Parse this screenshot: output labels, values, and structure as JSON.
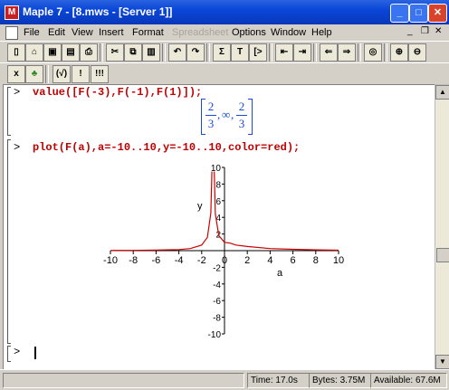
{
  "window": {
    "app_name": "Maple 7",
    "title": "Maple 7 - [8.mws - [Server 1]]"
  },
  "menu": [
    "File",
    "Edit",
    "View",
    "Insert",
    "Format",
    "Spreadsheet",
    "Options",
    "Window",
    "Help"
  ],
  "menu_disabled": [
    "Spreadsheet"
  ],
  "worksheet": {
    "prompt1": ">",
    "cmd1": "value([F(-3),F(-1),F(1)]);",
    "result": {
      "frac1_num": "2",
      "frac1_den": "3",
      "sep1": ",",
      "inf": "∞",
      "sep2": ",",
      "frac2_num": "2",
      "frac2_den": "3"
    },
    "prompt2": ">",
    "cmd2": "plot(F(a),a=-10..10,y=-10..10,color=red);",
    "prompt3": ">"
  },
  "chart_data": {
    "type": "line",
    "xlabel": "a",
    "ylabel": "y",
    "xlim": [
      -10,
      10
    ],
    "ylim": [
      -10,
      10
    ],
    "x_ticks": [
      "-10",
      "-8",
      "-6",
      "-4",
      "-2",
      "0",
      "2",
      "4",
      "6",
      "8",
      "10"
    ],
    "y_ticks": [
      "10",
      "8",
      "6",
      "4",
      "2",
      "-2",
      "-4",
      "-6",
      "-8",
      "-10"
    ],
    "series": [
      {
        "color": "#cc0000",
        "x": [
          -10,
          -8,
          -6,
          -4,
          -3,
          -2,
          -1.5,
          -1.2,
          -1.1
        ],
        "y": [
          0.02,
          0.03,
          0.06,
          0.13,
          0.25,
          0.67,
          1.6,
          4.5,
          9.5
        ]
      },
      {
        "color": "#cc0000",
        "x": [
          -0.9,
          -0.8,
          -0.5,
          0,
          0.5,
          1,
          2,
          4,
          6,
          8,
          10
        ],
        "y": [
          9.5,
          4.4,
          1.8,
          1,
          0.9,
          0.67,
          0.5,
          0.25,
          0.16,
          0.1,
          0.05
        ]
      }
    ],
    "grid": false
  },
  "status": {
    "time": "Time: 17.0s",
    "bytes": "Bytes: 3.75M",
    "available": "Available: 67.6M"
  }
}
